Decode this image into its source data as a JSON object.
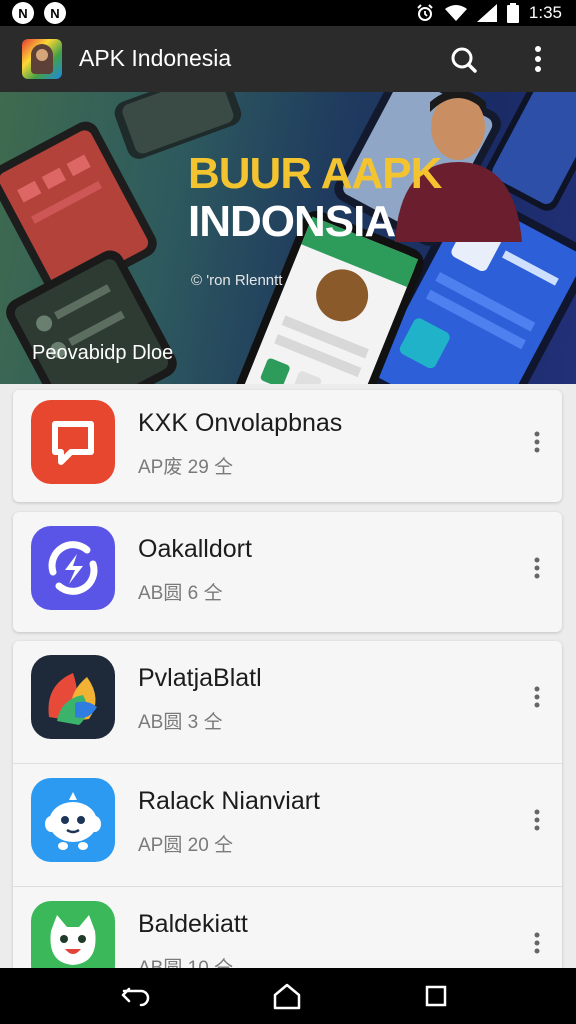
{
  "status_bar": {
    "left_icons": [
      "notification-icon-1",
      "notification-icon-2"
    ],
    "left_glyphs": [
      "N",
      "N"
    ],
    "time": "1:35",
    "right_icons": [
      "alarm-icon",
      "wifi-icon",
      "signal-icon",
      "battery-icon"
    ]
  },
  "app_bar": {
    "title": "APK Indonesia",
    "icons": [
      "app-logo",
      "search-icon",
      "more-vert-icon"
    ]
  },
  "banner": {
    "title_line1": "BUUR AAPK",
    "title_line2": "INDONSIA",
    "credit": "© 'ron Rlenntt",
    "caption": "Peovabidp Dloe",
    "colors": {
      "title_accent": "#f4c430",
      "title_text": "#ffffff"
    }
  },
  "apps": [
    {
      "name": "KXK Onvolapbnas",
      "meta": "AP废 29 仝",
      "icon": "chat-bubble-icon",
      "icon_color": "#e8472f"
    },
    {
      "name": "Oakalldort",
      "meta": "AB圆 6 仝",
      "icon": "sync-bolt-icon",
      "icon_color": "#5a55e6"
    },
    {
      "name": "PvlatjaBlatl",
      "meta": "AB圆 3 仝",
      "icon": "colorful-leaf-icon",
      "icon_color": "#1e2a3a"
    },
    {
      "name": "Ralack Nianviart",
      "meta": "AP圆 20 仝",
      "icon": "robot-mascot-icon",
      "icon_color": "#2b9af0"
    },
    {
      "name": "Baldekiatt",
      "meta": "AB圆 10 仝",
      "icon": "cat-face-icon",
      "icon_color": "#3ab85a"
    }
  ],
  "nav_bar": {
    "icons": [
      "back-icon",
      "home-icon",
      "recents-icon"
    ]
  }
}
